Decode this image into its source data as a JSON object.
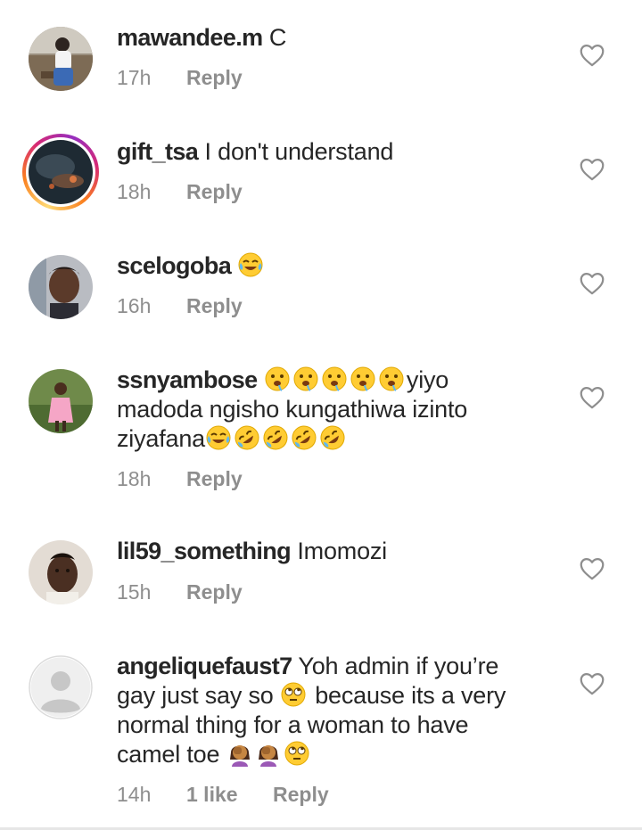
{
  "comments": [
    {
      "username": "mawandee.m",
      "text": " C",
      "time": "17h",
      "reply": "Reply",
      "avatar": "person-photo-icon"
    },
    {
      "username": "gift_tsa",
      "text": " I don't understand",
      "time": "18h",
      "reply": "Reply",
      "avatar": "story-ring-photo-icon"
    },
    {
      "username": "scelogoba",
      "text": " ",
      "emojis": [
        "face-with-tears-of-joy"
      ],
      "time": "16h",
      "reply": "Reply",
      "avatar": "person-photo-icon"
    },
    {
      "username": "ssnyambose",
      "text_line1_after_emojis": "yiyo",
      "text_line2": "madoda ngisho kungathiwa izinto",
      "text_line3": "ziyafana",
      "emojis_line1": [
        "drooling-face",
        "drooling-face",
        "drooling-face",
        "drooling-face",
        "drooling-face"
      ],
      "emojis_line3": [
        "face-with-tears-of-joy",
        "rolling-on-floor-laughing",
        "rolling-on-floor-laughing",
        "rolling-on-floor-laughing",
        "rolling-on-floor-laughing"
      ],
      "time": "18h",
      "reply": "Reply",
      "avatar": "person-photo-icon"
    },
    {
      "username": "lil59_something",
      "text": " Imomozi",
      "time": "15h",
      "reply": "Reply",
      "avatar": "person-photo-icon"
    },
    {
      "username": "angeliquefaust7",
      "text_line1": " Yoh admin if you’re",
      "text_line2a": "gay just say so ",
      "text_line2b": " because its a very",
      "text_line3": "normal thing for a woman to have",
      "text_line4": "camel toe ",
      "emojis_line2": [
        "face-with-rolling-eyes"
      ],
      "emojis_line4": [
        "woman-facepalming",
        "woman-facepalming",
        "face-with-rolling-eyes"
      ],
      "time": "14h",
      "likes": "1 like",
      "reply": "Reply",
      "avatar": "default-avatar-icon"
    }
  ],
  "colors": {
    "text": "#262626",
    "meta": "#8e8e8e",
    "heart": "#8e8e8e"
  },
  "icons": {
    "like": "heart-outline-icon"
  }
}
